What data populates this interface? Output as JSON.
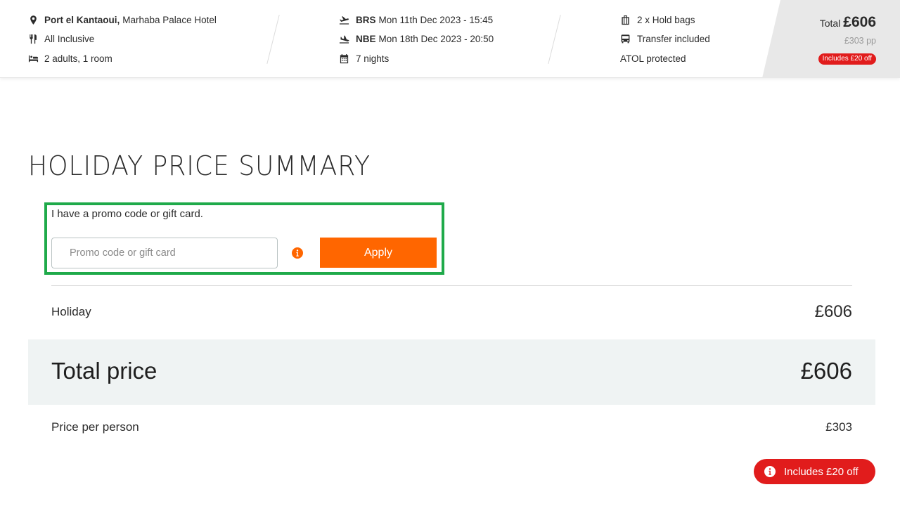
{
  "header": {
    "col1": {
      "destination": "Port el Kantaoui,",
      "hotel": "Marhaba Palace Hotel",
      "board": "All Inclusive",
      "occupancy": "2 adults, 1 room",
      "icons": [
        "location-pin-icon",
        "cutlery-icon",
        "bed-icon"
      ]
    },
    "col2": {
      "outbound_code": "BRS",
      "outbound_date": "Mon 11th Dec 2023 - 15:45",
      "return_code": "NBE",
      "return_date": "Mon 18th Dec 2023 - 20:50",
      "nights": "7 nights",
      "icons": [
        "plane-departure-icon",
        "plane-arrival-icon",
        "calendar-icon"
      ]
    },
    "col3": {
      "bags": "2 x Hold bags",
      "transfer": "Transfer included",
      "atol": "ATOL protected",
      "icons": [
        "luggage-icon",
        "bus-icon"
      ]
    },
    "total": {
      "label": "Total",
      "amount": "£606",
      "per_person": "£303 pp",
      "discount_badge": "Includes £20 off"
    }
  },
  "main": {
    "heading": "HOLIDAY PRICE SUMMARY",
    "promo": {
      "label": "I have a promo code or gift card.",
      "placeholder": "Promo code or gift card",
      "value": "",
      "apply_label": "Apply"
    },
    "lines": {
      "holiday_label": "Holiday",
      "holiday_value": "£606",
      "total_label": "Total price",
      "total_value": "£606",
      "pp_label": "Price per person",
      "pp_value": "£303"
    },
    "discount_pill": "Includes £20 off"
  },
  "colors": {
    "accent": "#ff6600",
    "discount": "#e11c1c",
    "highlight_border": "#1faa4a",
    "total_row_bg": "#eff3f3"
  }
}
